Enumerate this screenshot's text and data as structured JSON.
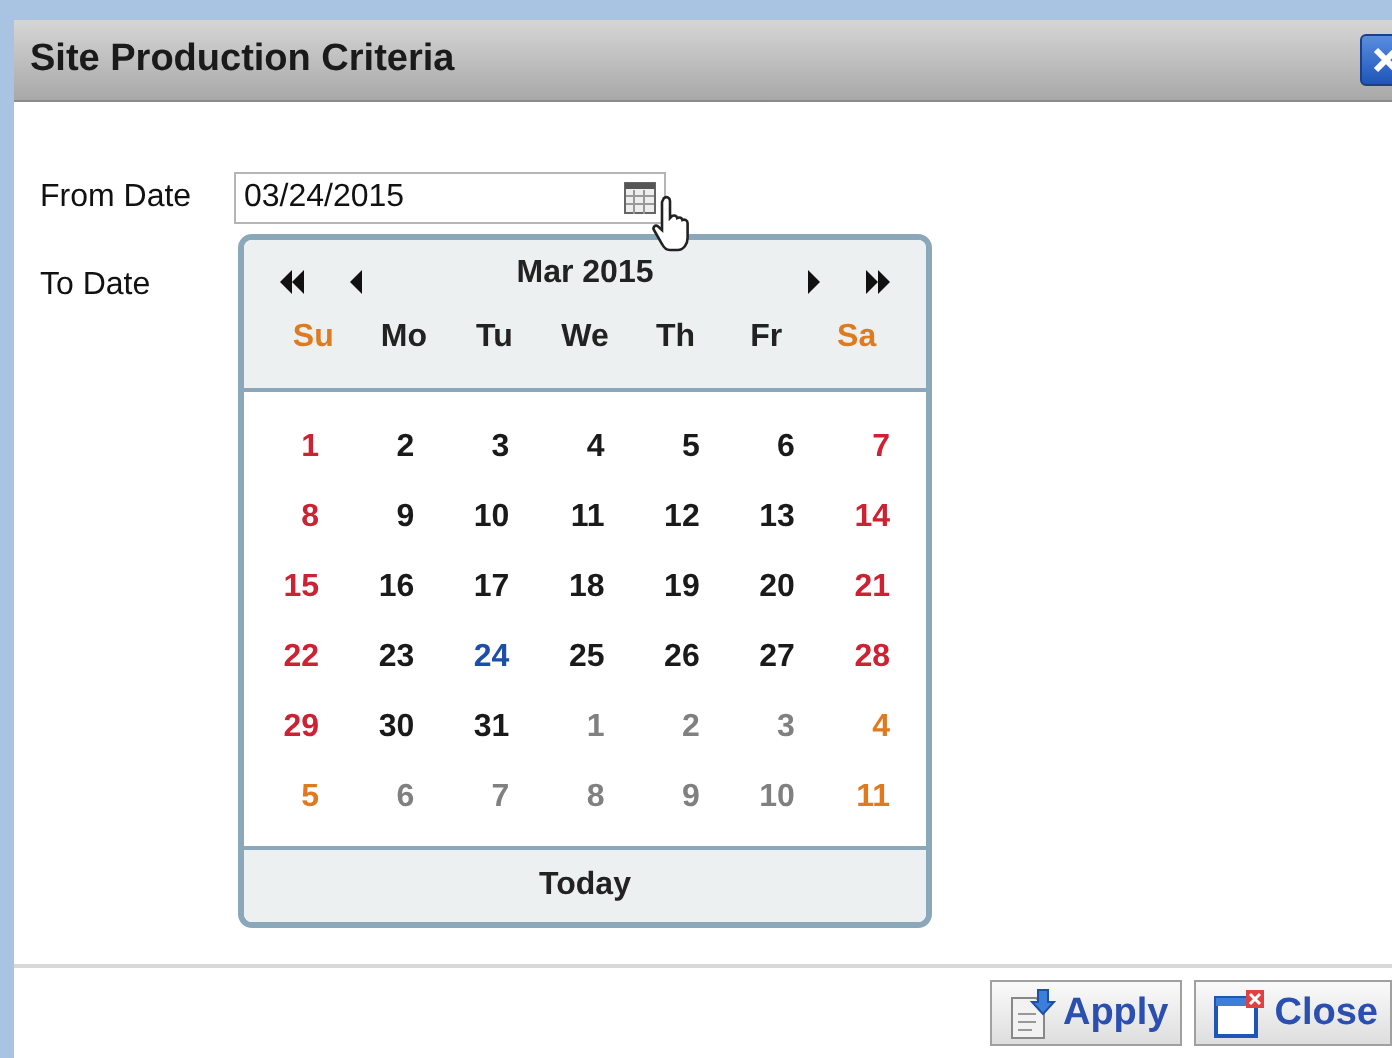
{
  "window": {
    "title": "Site Production Criteria"
  },
  "fields": [
    {
      "label": "From Date",
      "value": "03/24/2015"
    },
    {
      "label": "To Date"
    }
  ],
  "calendar": {
    "month": "Mar 2015",
    "weekdays": [
      {
        "label": "Su",
        "weekend": true
      },
      {
        "label": "Mo",
        "weekend": false
      },
      {
        "label": "Tu",
        "weekend": false
      },
      {
        "label": "We",
        "weekend": false
      },
      {
        "label": "Th",
        "weekend": false
      },
      {
        "label": "Fr",
        "weekend": false
      },
      {
        "label": "Sa",
        "weekend": true
      }
    ],
    "weeks": [
      [
        {
          "label": "1",
          "kind": "weekend",
          "selected": false
        },
        {
          "label": "2",
          "kind": "weekday",
          "selected": false
        },
        {
          "label": "3",
          "kind": "weekday",
          "selected": false
        },
        {
          "label": "4",
          "kind": "weekday",
          "selected": false
        },
        {
          "label": "5",
          "kind": "weekday",
          "selected": false
        },
        {
          "label": "6",
          "kind": "weekday",
          "selected": false
        },
        {
          "label": "7",
          "kind": "weekend",
          "selected": false
        }
      ],
      [
        {
          "label": "8",
          "kind": "weekend",
          "selected": false
        },
        {
          "label": "9",
          "kind": "weekday",
          "selected": false
        },
        {
          "label": "10",
          "kind": "weekday",
          "selected": false
        },
        {
          "label": "11",
          "kind": "weekday",
          "selected": false
        },
        {
          "label": "12",
          "kind": "weekday",
          "selected": false
        },
        {
          "label": "13",
          "kind": "weekday",
          "selected": false
        },
        {
          "label": "14",
          "kind": "weekend",
          "selected": false
        }
      ],
      [
        {
          "label": "15",
          "kind": "weekend",
          "selected": false
        },
        {
          "label": "16",
          "kind": "weekday",
          "selected": false
        },
        {
          "label": "17",
          "kind": "weekday",
          "selected": false
        },
        {
          "label": "18",
          "kind": "weekday",
          "selected": false
        },
        {
          "label": "19",
          "kind": "weekday",
          "selected": false
        },
        {
          "label": "20",
          "kind": "weekday",
          "selected": false
        },
        {
          "label": "21",
          "kind": "weekend",
          "selected": false
        }
      ],
      [
        {
          "label": "22",
          "kind": "weekend",
          "selected": false
        },
        {
          "label": "23",
          "kind": "weekday",
          "selected": false
        },
        {
          "label": "24",
          "kind": "weekday",
          "selected": true
        },
        {
          "label": "25",
          "kind": "weekday",
          "selected": false
        },
        {
          "label": "26",
          "kind": "weekday",
          "selected": false
        },
        {
          "label": "27",
          "kind": "weekday",
          "selected": false
        },
        {
          "label": "28",
          "kind": "weekend",
          "selected": false
        }
      ],
      [
        {
          "label": "29",
          "kind": "weekend",
          "selected": false
        },
        {
          "label": "30",
          "kind": "weekday",
          "selected": false
        },
        {
          "label": "31",
          "kind": "weekday",
          "selected": false
        },
        {
          "label": "1",
          "kind": "other",
          "selected": false
        },
        {
          "label": "2",
          "kind": "other",
          "selected": false
        },
        {
          "label": "3",
          "kind": "other",
          "selected": false
        },
        {
          "label": "4",
          "kind": "other-weekend",
          "selected": false
        }
      ],
      [
        {
          "label": "5",
          "kind": "other-weekend",
          "selected": false
        },
        {
          "label": "6",
          "kind": "other",
          "selected": false
        },
        {
          "label": "7",
          "kind": "other",
          "selected": false
        },
        {
          "label": "8",
          "kind": "other",
          "selected": false
        },
        {
          "label": "9",
          "kind": "other",
          "selected": false
        },
        {
          "label": "10",
          "kind": "other",
          "selected": false
        },
        {
          "label": "11",
          "kind": "other-weekend",
          "selected": false
        }
      ]
    ],
    "today": "Today"
  },
  "buttons": [
    {
      "label": "Apply",
      "kind": "apply"
    },
    {
      "label": "Close",
      "kind": "close"
    }
  ]
}
